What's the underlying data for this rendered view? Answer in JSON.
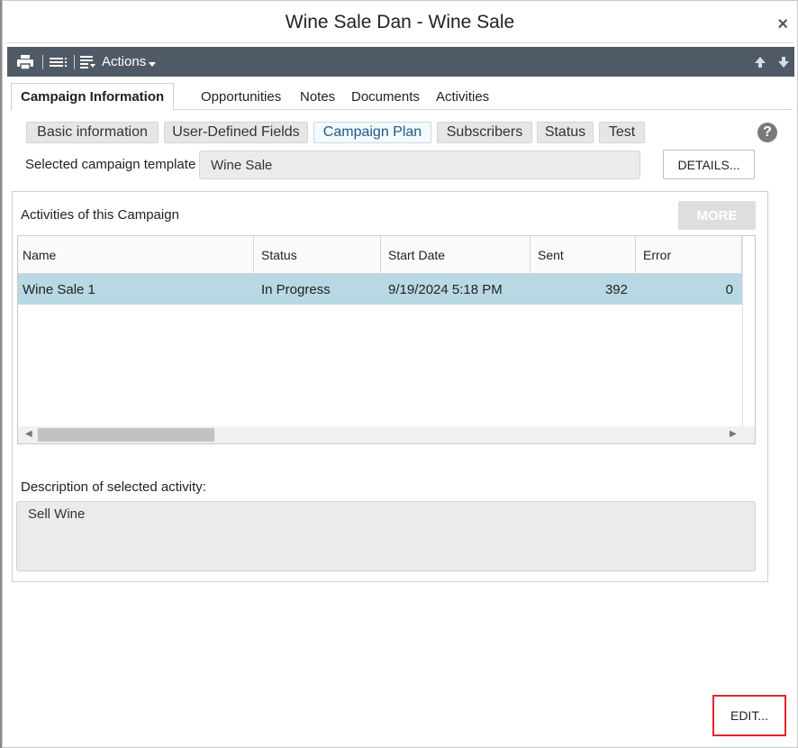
{
  "window": {
    "title": "Wine Sale Dan - Wine Sale",
    "close_glyph": "×"
  },
  "toolbar": {
    "print_icon": "printer-icon",
    "list_icon": "list-icon",
    "actions_label": "Actions",
    "actions_icon": "actions-list-icon",
    "up_icon": "arrow-up-icon",
    "down_icon": "arrow-down-icon",
    "background_color": "#505a66"
  },
  "main_tabs": [
    {
      "label": "Campaign Information",
      "active": true
    },
    {
      "label": "Opportunities",
      "active": false
    },
    {
      "label": "Notes",
      "active": false
    },
    {
      "label": "Documents",
      "active": false
    },
    {
      "label": "Activities",
      "active": false
    }
  ],
  "sub_tabs": [
    {
      "label": "Basic information",
      "active": false
    },
    {
      "label": "User-Defined Fields",
      "active": false
    },
    {
      "label": "Campaign Plan",
      "active": true
    },
    {
      "label": "Subscribers",
      "active": false
    },
    {
      "label": "Status",
      "active": false
    },
    {
      "label": "Test",
      "active": false
    }
  ],
  "help_glyph": "?",
  "template": {
    "label": "Selected campaign template",
    "value": "Wine Sale",
    "details_button": "DETAILS..."
  },
  "activities": {
    "title": "Activities of this Campaign",
    "more_button": "MORE",
    "columns": [
      "Name",
      "Status",
      "Start Date",
      "Sent",
      "Error"
    ],
    "rows": [
      {
        "name": "Wine Sale 1",
        "status": "In Progress",
        "start_date": "9/19/2024 5:18 PM",
        "sent": "392",
        "error": "0",
        "selected": true
      }
    ],
    "selected_row_color": "#b8d8e4"
  },
  "description": {
    "label": "Description of selected activity:",
    "value": "Sell Wine"
  },
  "edit_button": "EDIT...",
  "highlight_color": "#e0242c"
}
